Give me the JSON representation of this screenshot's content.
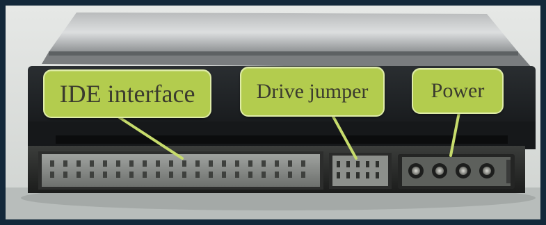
{
  "image": {
    "subject": "hard-drive-rear-connectors",
    "colors": {
      "border": "#13283a",
      "background_wall": "#d9dcd9",
      "drive_body": "#1a1d20",
      "callout_fill": "#b3cc4e",
      "callout_border": "#dfeca8",
      "callout_text": "#3b3b2e",
      "pointer_line": "#c7dc6c"
    }
  },
  "callouts": {
    "ide_interface": "IDE interface",
    "drive_jumper": "Drive jumper",
    "power": "Power"
  }
}
